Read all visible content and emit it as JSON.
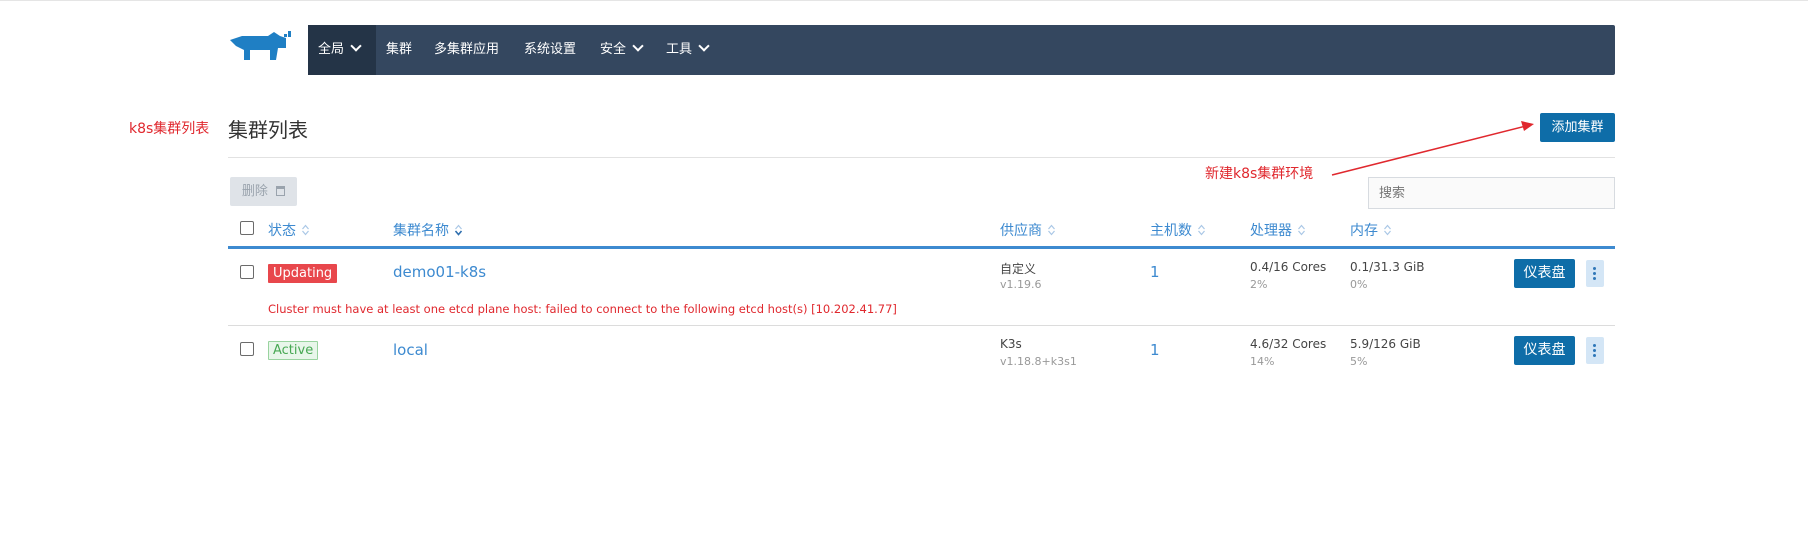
{
  "header": {
    "nav": [
      {
        "label": "全局",
        "dropdown": true
      },
      {
        "label": "集群",
        "dropdown": false
      },
      {
        "label": "多集群应用",
        "dropdown": false
      },
      {
        "label": "系统设置",
        "dropdown": false
      },
      {
        "label": "安全",
        "dropdown": true
      },
      {
        "label": "工具",
        "dropdown": true
      }
    ],
    "logo_icon": "rancher-cow-icon",
    "avatar_icon": "user-avatar-icon"
  },
  "annotations": {
    "left_label": "k8s集群列表",
    "arrow_label": "新建k8s集群环境"
  },
  "page": {
    "title": "集群列表",
    "add_button": "添加集群",
    "delete_button": "删除",
    "search_placeholder": "搜索"
  },
  "table": {
    "columns": [
      "状态",
      "集群名称",
      "供应商",
      "主机数",
      "处理器",
      "内存"
    ],
    "rows": [
      {
        "state": "Updating",
        "name": "demo01-k8s",
        "provider": "自定义",
        "version": "v1.19.6",
        "nodes": "1",
        "cpu": "0.4/16 Cores",
        "cpu_pct": "2%",
        "mem": "0.1/31.3 GiB",
        "mem_pct": "0%",
        "error": "Cluster must have at least one etcd plane host: failed to connect to the following etcd host(s) [10.202.41.77]",
        "action": "仪表盘"
      },
      {
        "state": "Active",
        "name": "local",
        "provider": "K3s",
        "version": "v1.18.8+k3s1",
        "nodes": "1",
        "cpu": "4.6/32 Cores",
        "cpu_pct": "14%",
        "mem": "5.9/126 GiB",
        "mem_pct": "5%",
        "action": "仪表盘"
      }
    ]
  },
  "colors": {
    "navbar": "#34475f",
    "nav_active": "#243447",
    "primary_button": "#0e6da8",
    "link": "#3d8ad0",
    "annotation_red": "#e0282e",
    "updating_badge": "#e8474c",
    "active_badge": "#47a853"
  }
}
